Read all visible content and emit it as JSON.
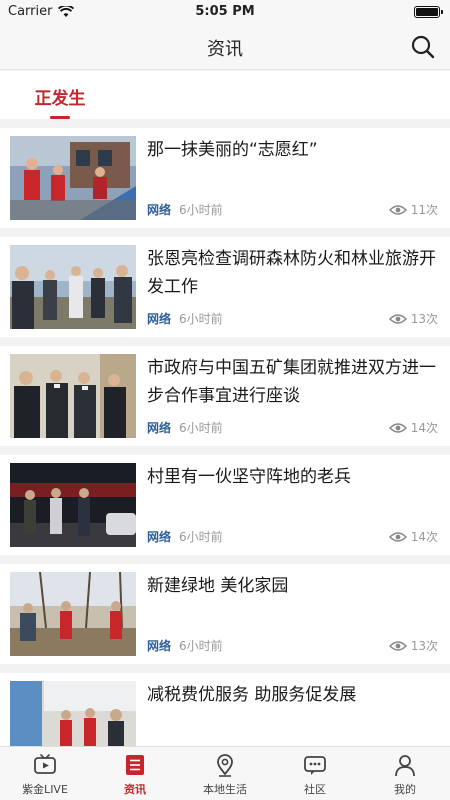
{
  "status_bar": {
    "carrier": "Carrier",
    "time": "5:05 PM"
  },
  "header": {
    "title": "资讯",
    "search_icon": "search-icon"
  },
  "tabs": [
    {
      "label": "正发生",
      "active": true
    }
  ],
  "accent_color": "#c3272b",
  "news": [
    {
      "title": "那一抹美丽的“志愿红”",
      "source": "网络",
      "time": "6小时前",
      "views": "11次"
    },
    {
      "title": "张恩亮检查调研森林防火和林业旅游开发工作",
      "source": "网络",
      "time": "6小时前",
      "views": "13次"
    },
    {
      "title": "市政府与中国五矿集团就推进双方进一步合作事宜进行座谈",
      "source": "网络",
      "time": "6小时前",
      "views": "14次"
    },
    {
      "title": "村里有一伙坚守阵地的老兵",
      "source": "网络",
      "time": "6小时前",
      "views": "14次"
    },
    {
      "title": "新建绿地 美化家园",
      "source": "网络",
      "time": "6小时前",
      "views": "13次"
    },
    {
      "title": "减税费优服务 助服务促发展",
      "source": "",
      "time": "",
      "views": ""
    }
  ],
  "bottom_nav": [
    {
      "label": "紫金LIVE",
      "icon": "tv-icon"
    },
    {
      "label": "资讯",
      "icon": "news-icon",
      "active": true
    },
    {
      "label": "本地生活",
      "icon": "location-icon"
    },
    {
      "label": "社区",
      "icon": "chat-icon"
    },
    {
      "label": "我的",
      "icon": "person-icon"
    }
  ]
}
